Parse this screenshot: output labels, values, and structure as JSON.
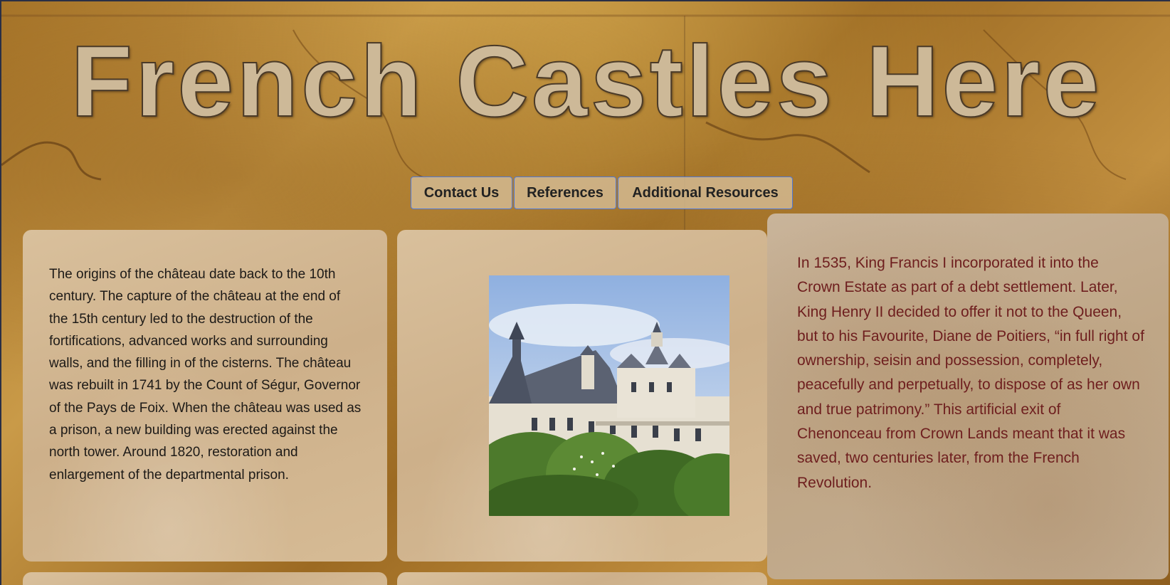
{
  "header": {
    "title": "French Castles Here"
  },
  "nav": {
    "items": [
      {
        "label": "Contact Us"
      },
      {
        "label": "References"
      },
      {
        "label": "Additional Resources"
      }
    ]
  },
  "left_card": {
    "text": "The origins of the château date back to the 10th century. The capture of the château at the end of the 15th century led to the destruction of the fortifications, advanced works and surrounding walls, and the filling in of the cisterns. The château was rebuilt in 1741 by the Count of Ségur, Governor of the Pays de Foix. When the château was used as a prison, a new building was erected against the north tower. Around 1820, restoration and enlargement of the departmental prison."
  },
  "right_card": {
    "text": "In 1535, King Francis I incorporated it into the Crown Estate as part of a debt settlement. Later, King Henry II decided to offer it not to the Queen, but to his Favourite, Diane de Poitiers, “in full right of ownership, seisin and possession, completely, peacefully and perpetually, to dispose of as her own and true patrimony.” This artificial exit of Chenonceau from Crown Lands meant that it was saved, two centuries later, from the French Revolution."
  },
  "colors": {
    "background": "#a8762a",
    "title_fill": "#cdb998",
    "nav_border": "#4f78d6",
    "right_text": "#6e1e1e",
    "left_text": "#1d1a17"
  }
}
